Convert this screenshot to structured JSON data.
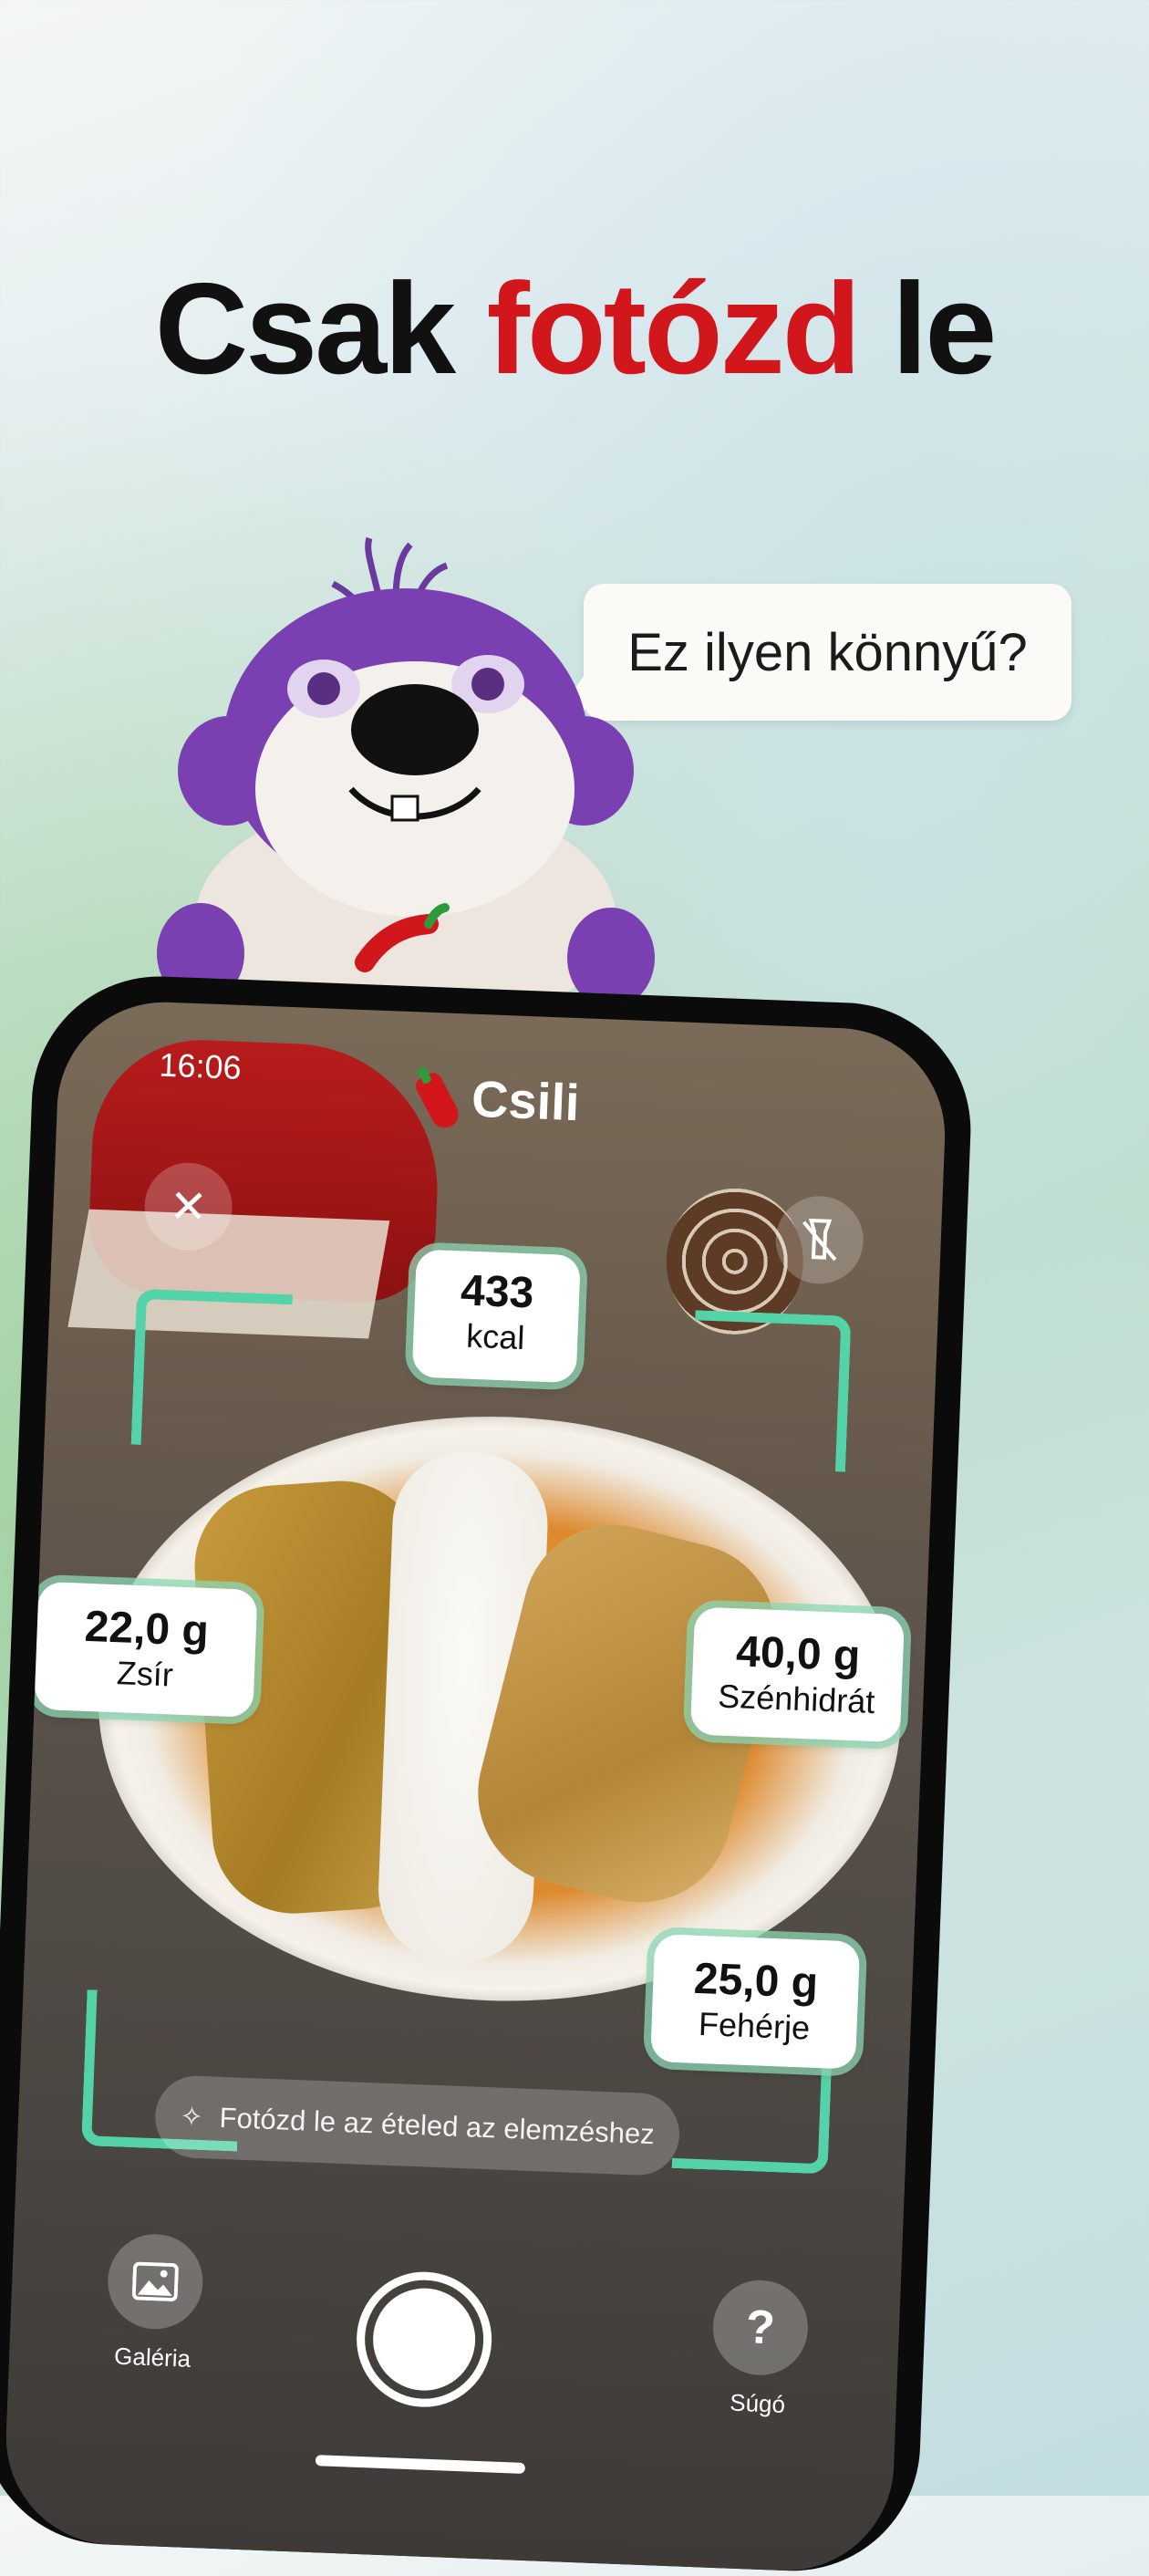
{
  "headline": {
    "part1": "Csak ",
    "accent": "fotózd",
    "part2": " le"
  },
  "speech_bubble": "Ez ilyen könnyű?",
  "phone": {
    "status_time": "16:06",
    "brand": "Csili",
    "nutrition": [
      {
        "value": "433",
        "label": "kcal"
      },
      {
        "value": "22,0 g",
        "label": "Zsír"
      },
      {
        "value": "40,0 g",
        "label": "Szénhidrát"
      },
      {
        "value": "25,0 g",
        "label": "Fehérje"
      }
    ],
    "hint": "Fotózd le az ételed az elemzéshez",
    "gallery_label": "Galéria",
    "help_label": "Súgó",
    "help_icon": "?",
    "close_icon": "close-icon",
    "flashlight_icon": "flashlight-off-icon"
  },
  "colors": {
    "accent_red": "#d1161c",
    "scan_frame_green": "#55d3a8"
  }
}
